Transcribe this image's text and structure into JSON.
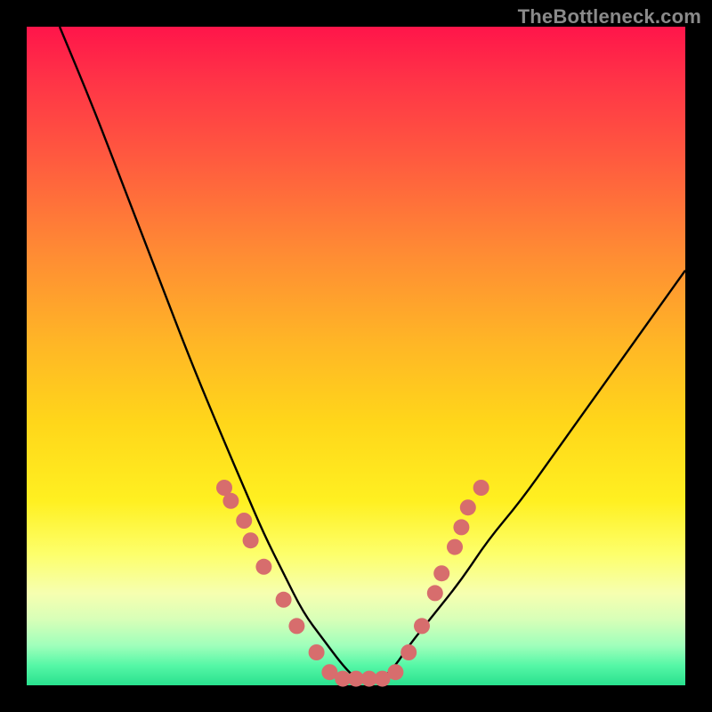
{
  "watermark": "TheBottleneck.com",
  "chart_data": {
    "type": "line",
    "title": "",
    "xlabel": "",
    "ylabel": "",
    "xlim": [
      0,
      100
    ],
    "ylim": [
      0,
      100
    ],
    "grid": false,
    "series": [
      {
        "name": "bottleneck-curve",
        "x": [
          5,
          10,
          15,
          20,
          25,
          30,
          33,
          36,
          39,
          42,
          45,
          48,
          50,
          52,
          54,
          56,
          58,
          62,
          66,
          70,
          75,
          80,
          85,
          90,
          95,
          100
        ],
        "y": [
          100,
          88,
          75,
          62,
          49,
          37,
          30,
          23,
          17,
          11,
          7,
          3,
          1,
          1,
          1,
          3,
          6,
          11,
          16,
          22,
          28,
          35,
          42,
          49,
          56,
          63
        ]
      }
    ],
    "markers": [
      {
        "x": 30,
        "y": 30
      },
      {
        "x": 31,
        "y": 28
      },
      {
        "x": 33,
        "y": 25
      },
      {
        "x": 34,
        "y": 22
      },
      {
        "x": 36,
        "y": 18
      },
      {
        "x": 39,
        "y": 13
      },
      {
        "x": 41,
        "y": 9
      },
      {
        "x": 44,
        "y": 5
      },
      {
        "x": 46,
        "y": 2
      },
      {
        "x": 48,
        "y": 1
      },
      {
        "x": 50,
        "y": 1
      },
      {
        "x": 52,
        "y": 1
      },
      {
        "x": 54,
        "y": 1
      },
      {
        "x": 56,
        "y": 2
      },
      {
        "x": 58,
        "y": 5
      },
      {
        "x": 60,
        "y": 9
      },
      {
        "x": 62,
        "y": 14
      },
      {
        "x": 63,
        "y": 17
      },
      {
        "x": 65,
        "y": 21
      },
      {
        "x": 66,
        "y": 24
      },
      {
        "x": 67,
        "y": 27
      },
      {
        "x": 69,
        "y": 30
      }
    ],
    "marker_color": "#d76d6d",
    "curve_color": "#000000",
    "gradient_stops": [
      {
        "offset": 0,
        "color": "#ff154a"
      },
      {
        "offset": 8,
        "color": "#ff3347"
      },
      {
        "offset": 20,
        "color": "#ff5a3f"
      },
      {
        "offset": 34,
        "color": "#ff8a34"
      },
      {
        "offset": 48,
        "color": "#ffb626"
      },
      {
        "offset": 60,
        "color": "#ffd61a"
      },
      {
        "offset": 72,
        "color": "#fff021"
      },
      {
        "offset": 80,
        "color": "#fdff6a"
      },
      {
        "offset": 86,
        "color": "#f6ffb0"
      },
      {
        "offset": 90,
        "color": "#d8ffb8"
      },
      {
        "offset": 94,
        "color": "#9fffbb"
      },
      {
        "offset": 97,
        "color": "#55f7a6"
      },
      {
        "offset": 100,
        "color": "#29e18e"
      }
    ]
  }
}
